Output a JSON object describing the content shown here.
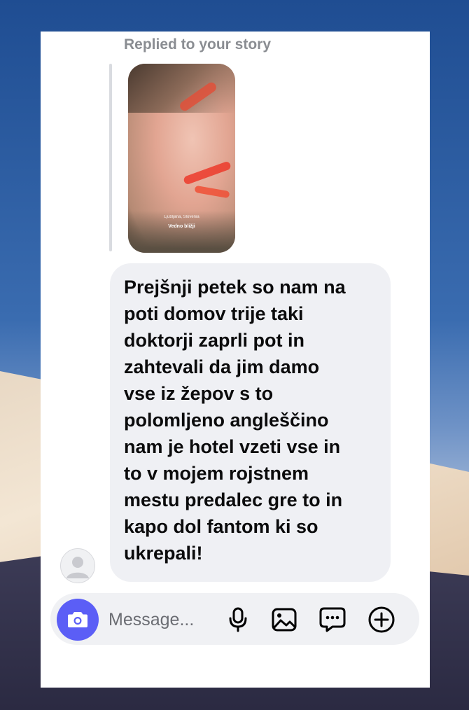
{
  "reply_header": "Replied to your story",
  "story": {
    "location_tag": "Ljubljana, Slovenia",
    "caption": "Vedno bližji"
  },
  "message": {
    "lines": [
      "Prejšnji petek so nam na",
      "poti domov trije taki",
      "doktorji zaprli pot in",
      "zahtevali da jim damo",
      "vse iz žepov s to",
      "polomljeno angleščino",
      "nam je hotel vzeti vse in",
      "to v mojem rojstnem",
      "mestu predalec gre to in",
      "kapo dol fantom ki so",
      "ukrepali!"
    ]
  },
  "composer": {
    "placeholder": "Message...",
    "icons": [
      "camera-icon",
      "microphone-icon",
      "gallery-icon",
      "sticker-chat-icon",
      "plus-icon"
    ]
  },
  "colors": {
    "accent": "#5b5ef6",
    "bubble": "#eff0f4",
    "text": "#0b0b0c",
    "muted": "#8a8d92"
  }
}
